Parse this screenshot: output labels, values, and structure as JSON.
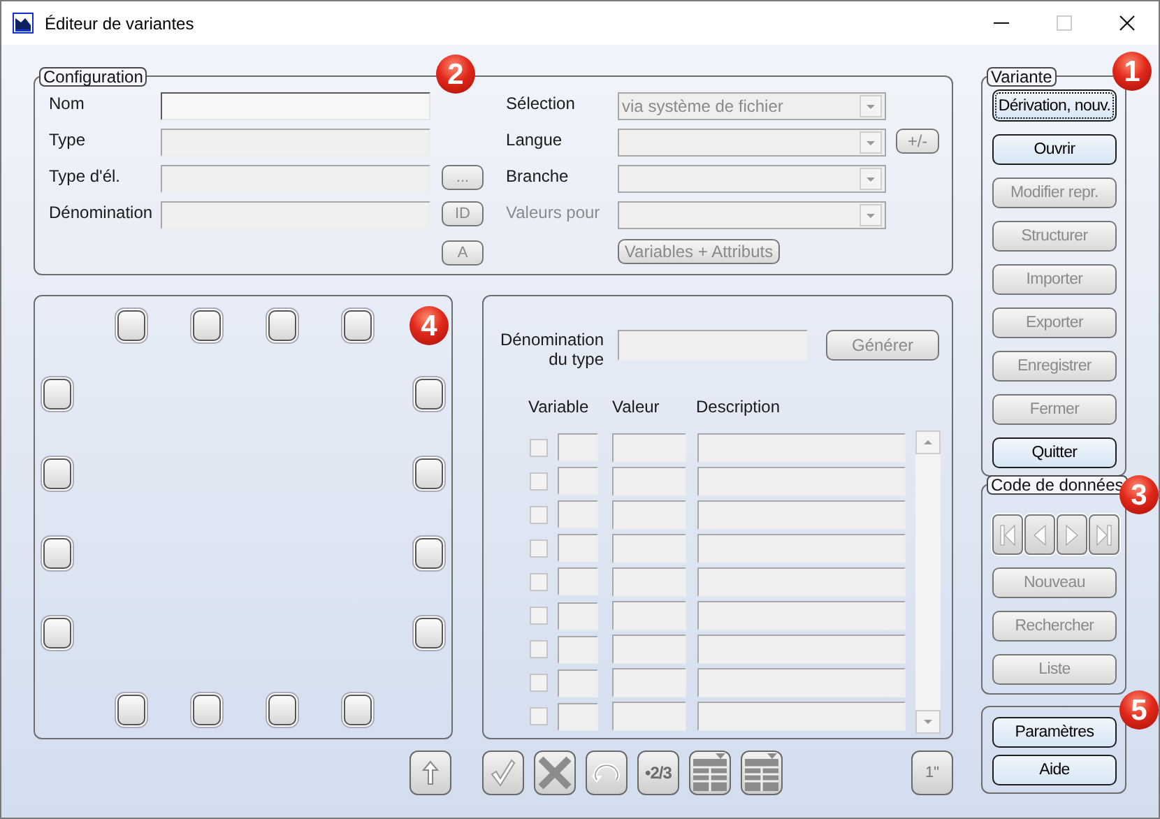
{
  "window": {
    "title": "Éditeur de variantes",
    "maximize_disabled": true
  },
  "configuration": {
    "title": "Configuration",
    "badge": "2",
    "left_rows": [
      {
        "label": "Nom",
        "disabled": false
      },
      {
        "label": "Type",
        "disabled": true
      },
      {
        "label": "Type d'él.",
        "disabled": true,
        "button": {
          "label": "...",
          "disabled": true
        }
      },
      {
        "label": "Dénomination",
        "disabled": true,
        "button": {
          "label": "ID",
          "disabled": true
        }
      }
    ],
    "extra_button": {
      "label": "A",
      "disabled": true
    },
    "right_rows": [
      {
        "label": "Sélection",
        "value": "via système de fichier",
        "dimmed": false
      },
      {
        "label": "Langue",
        "dimmed": false,
        "button": {
          "label": "+/-",
          "disabled": true
        }
      },
      {
        "label": "Branche",
        "dimmed": false
      },
      {
        "label": "Valeurs pour",
        "dimmed": true
      }
    ],
    "right_button": {
      "label": "Variables + Attributs",
      "disabled": true
    }
  },
  "layout_panel": {
    "badge": "4",
    "toolbar": [
      {
        "kind": "up"
      }
    ]
  },
  "type_panel": {
    "label": "Dénomination du type",
    "generate_button": {
      "label": "Générer",
      "disabled": true
    },
    "columns": [
      "Variable",
      "Valeur",
      "Description"
    ],
    "rows": [
      {
        "checked": false
      },
      {
        "checked": false
      },
      {
        "checked": false
      },
      {
        "checked": false
      },
      {
        "checked": false
      },
      {
        "checked": false
      },
      {
        "checked": false
      },
      {
        "checked": false
      },
      {
        "checked": false
      }
    ],
    "toolbar": [
      {
        "kind": "check"
      },
      {
        "kind": "cancel"
      },
      {
        "kind": "undo"
      },
      {
        "kind": "fraction",
        "label": "•2/3"
      },
      {
        "kind": "table"
      },
      {
        "kind": "table"
      },
      {
        "kind": "text",
        "label": "1\""
      }
    ]
  },
  "variante": {
    "title": "Variante",
    "badge": "1",
    "buttons": [
      {
        "label": "Dérivation, nouv.",
        "disabled": false,
        "focused": true
      },
      {
        "label": "Ouvrir",
        "disabled": false,
        "focused": false
      },
      {
        "label": "Modifier repr.",
        "disabled": true,
        "focused": false
      },
      {
        "label": "Structurer",
        "disabled": true,
        "focused": false
      },
      {
        "label": "Importer",
        "disabled": true,
        "focused": false
      },
      {
        "label": "Exporter",
        "disabled": true,
        "focused": false
      },
      {
        "label": "Enregistrer",
        "disabled": true,
        "focused": false
      },
      {
        "label": "Fermer",
        "disabled": true,
        "focused": false
      },
      {
        "label": "Quitter",
        "disabled": false,
        "focused": false
      }
    ]
  },
  "data_code": {
    "title": "Code de données",
    "badge": "3",
    "nav": [
      {
        "kind": "first",
        "disabled": true
      },
      {
        "kind": "previous",
        "disabled": true
      },
      {
        "kind": "next",
        "disabled": true
      },
      {
        "kind": "last",
        "disabled": true
      }
    ],
    "buttons": [
      {
        "label": "Nouveau",
        "disabled": true
      },
      {
        "label": "Rechercher",
        "disabled": true
      },
      {
        "label": "Liste",
        "disabled": true
      }
    ]
  },
  "help_group": {
    "badge": "5",
    "buttons": [
      {
        "label": "Paramètres",
        "disabled": false
      },
      {
        "label": "Aide",
        "disabled": false
      }
    ]
  }
}
